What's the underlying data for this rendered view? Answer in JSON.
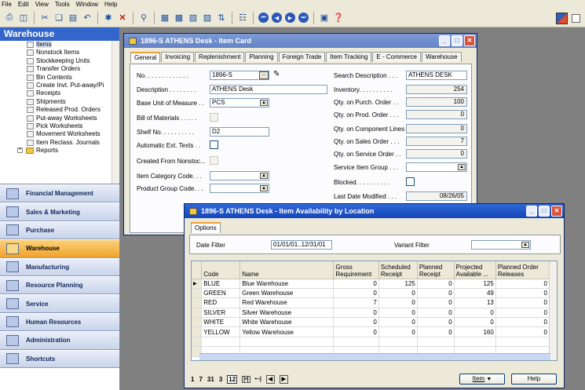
{
  "menubar": [
    "File",
    "Edit",
    "View",
    "Tools",
    "Window",
    "Help"
  ],
  "nav": {
    "title": "Warehouse",
    "tree_items": [
      {
        "label": "Items",
        "type": "item",
        "selected": true
      },
      {
        "label": "Nonstock Items",
        "type": "item"
      },
      {
        "label": "Stockkeeping Units",
        "type": "item"
      },
      {
        "label": "Transfer Orders",
        "type": "item"
      },
      {
        "label": "Bin Contents",
        "type": "item"
      },
      {
        "label": "Create Invt. Put-away/Pi",
        "type": "item"
      },
      {
        "label": "Receipts",
        "type": "item"
      },
      {
        "label": "Shipments",
        "type": "item"
      },
      {
        "label": "Released Prod. Orders",
        "type": "item"
      },
      {
        "label": "Put-away Worksheets",
        "type": "item"
      },
      {
        "label": "Pick Worksheets",
        "type": "item"
      },
      {
        "label": "Movement Worksheets",
        "type": "item"
      },
      {
        "label": "Item Reclass. Journals",
        "type": "item"
      },
      {
        "label": "Reports",
        "type": "folder"
      }
    ],
    "categories": [
      {
        "label": "Financial Management"
      },
      {
        "label": "Sales & Marketing"
      },
      {
        "label": "Purchase"
      },
      {
        "label": "Warehouse",
        "active": true
      },
      {
        "label": "Manufacturing"
      },
      {
        "label": "Resource Planning"
      },
      {
        "label": "Service"
      },
      {
        "label": "Human Resources"
      },
      {
        "label": "Administration"
      },
      {
        "label": "Shortcuts"
      }
    ]
  },
  "item_card": {
    "title": "1896-S ATHENS Desk - Item Card",
    "tabs": [
      "General",
      "Invoicing",
      "Replenishment",
      "Planning",
      "Foreign Trade",
      "Item Tracking",
      "E - Commerce",
      "Warehouse"
    ],
    "fields": {
      "no_label": "No. . . . . . . . . . . . .",
      "no_value": "1896-S",
      "description_label": "Description . . . . . . . .",
      "description_value": "ATHENS Desk",
      "base_uom_label": "Base Unit of Measure . .",
      "base_uom_value": "PCS",
      "bom_label": "Bill of Materials . . . . .",
      "shelf_label": "Shelf No. . . . . . . . . .",
      "shelf_value": "D2",
      "auto_ext_label": "Automatic Ext. Texts . .",
      "created_from_label": "Created From Nonstoc...",
      "item_cat_label": "Item Category Code. . .",
      "item_cat_value": "",
      "product_group_label": "Product Group Code. . .",
      "product_group_value": "",
      "search_desc_label": "Search Description . . .",
      "search_desc_value": "ATHENS DESK",
      "inventory_label": "Inventory. . . . . . . . . .",
      "inventory_value": "254",
      "qty_purch_label": "Qty. on Purch. Order . .",
      "qty_purch_value": "100",
      "qty_prod_label": "Qty. on Prod. Order . . .",
      "qty_prod_value": "0",
      "qty_comp_label": "Qty. on Component Lines",
      "qty_comp_value": "0",
      "qty_sales_label": "Qty. on Sales Order . . .",
      "qty_sales_value": "7",
      "qty_service_label": "Qty. on Service Order . .",
      "qty_service_value": "0",
      "service_group_label": "Service Item Group . . .",
      "service_group_value": "",
      "blocked_label": "Blocked. . . . . . . . . .",
      "last_modified_label": "Last Date Modified . . .",
      "last_modified_value": "08/26/05"
    }
  },
  "availability": {
    "title": "1896-S ATHENS Desk - Item Availability by Location",
    "tab": "Options",
    "date_filter_label": "Date Filter",
    "date_filter_value": "01/01/01..12/31/01",
    "variant_filter_label": "Variant Filter",
    "variant_filter_value": "",
    "columns": [
      "Code",
      "Name",
      "Gross Requirement",
      "Scheduled Receipt",
      "Planned Receipt",
      "Projected Available ...",
      "Planned Order Releases"
    ],
    "rows": [
      {
        "code": "BLUE",
        "name": "Blue Warehouse",
        "gross": "0",
        "sched": "125",
        "planned": "0",
        "proj": "125",
        "releases": "0",
        "current": true
      },
      {
        "code": "GREEN",
        "name": "Green Warehouse",
        "gross": "0",
        "sched": "0",
        "planned": "0",
        "proj": "49",
        "releases": "0"
      },
      {
        "code": "RED",
        "name": "Red Warehouse",
        "gross": "7",
        "sched": "0",
        "planned": "0",
        "proj": "13",
        "releases": "0"
      },
      {
        "code": "SILVER",
        "name": "Silver Warehouse",
        "gross": "0",
        "sched": "0",
        "planned": "0",
        "proj": "0",
        "releases": "0"
      },
      {
        "code": "WHITE",
        "name": "White Warehouse",
        "gross": "0",
        "sched": "0",
        "planned": "0",
        "proj": "0",
        "releases": "0"
      },
      {
        "code": "YELLOW",
        "name": "Yellow Warehouse",
        "gross": "0",
        "sched": "0",
        "planned": "0",
        "proj": "160",
        "releases": "0"
      }
    ],
    "periods": [
      "1",
      "7",
      "31",
      "3",
      "12"
    ],
    "item_button": "Item",
    "help_button": "Help"
  }
}
